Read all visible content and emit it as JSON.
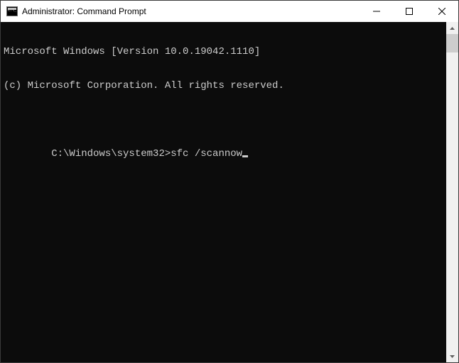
{
  "window": {
    "title": "Administrator: Command Prompt",
    "icon": "cmd-icon"
  },
  "controls": {
    "minimize": "minimize-icon",
    "maximize": "maximize-icon",
    "close": "close-icon"
  },
  "terminal": {
    "line1": "Microsoft Windows [Version 10.0.19042.1110]",
    "line2": "(c) Microsoft Corporation. All rights reserved.",
    "blank": "",
    "prompt": "C:\\Windows\\system32>",
    "command": "sfc /scannow"
  },
  "scrollbar": {
    "up": "arrow-up-icon",
    "down": "arrow-down-icon"
  }
}
